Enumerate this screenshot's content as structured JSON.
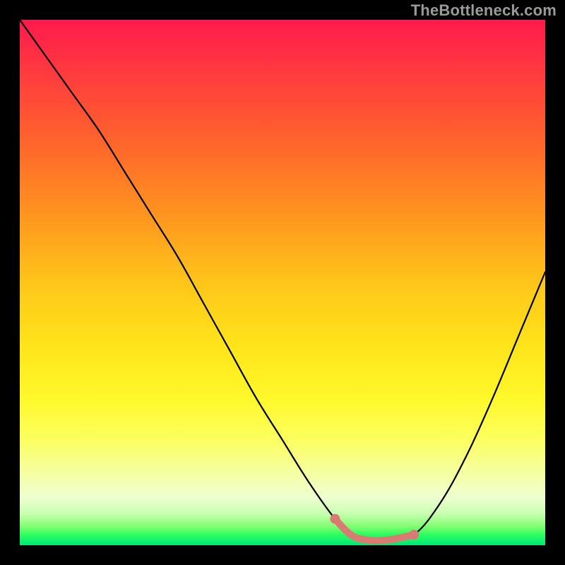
{
  "watermark": "TheBottleneck.com",
  "colors": {
    "frame": "#000000",
    "curve_stroke": "#000000",
    "highlight": "#d97a73",
    "gradient_top": "#ff1a4d",
    "gradient_bottom": "#00e676"
  },
  "chart_data": {
    "type": "line",
    "title": "",
    "xlabel": "",
    "ylabel": "",
    "xlim": [
      0,
      100
    ],
    "ylim": [
      0,
      100
    ],
    "grid": false,
    "legend": null,
    "series": [
      {
        "name": "bottleneck-curve",
        "x": [
          0,
          5,
          10,
          15,
          20,
          25,
          30,
          35,
          40,
          45,
          50,
          55,
          60,
          63,
          66,
          70,
          75,
          80,
          85,
          90,
          95,
          100
        ],
        "values": [
          100,
          93,
          86,
          79,
          71,
          63,
          55,
          46,
          37,
          28,
          20,
          12,
          5,
          2,
          1,
          1,
          2,
          8,
          17,
          28,
          40,
          52
        ]
      }
    ],
    "highlight_range_x": [
      60,
      75
    ],
    "annotations": []
  }
}
